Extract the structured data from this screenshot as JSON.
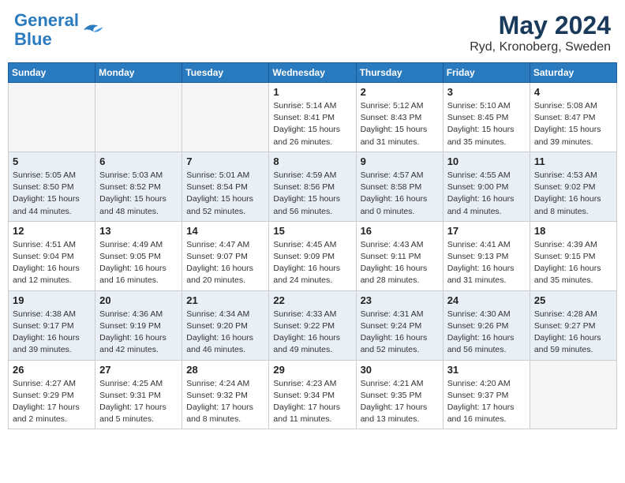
{
  "header": {
    "logo_line1": "General",
    "logo_line2": "Blue",
    "title": "May 2024",
    "subtitle": "Ryd, Kronoberg, Sweden"
  },
  "weekdays": [
    "Sunday",
    "Monday",
    "Tuesday",
    "Wednesday",
    "Thursday",
    "Friday",
    "Saturday"
  ],
  "weeks": [
    [
      {
        "day": "",
        "detail": ""
      },
      {
        "day": "",
        "detail": ""
      },
      {
        "day": "",
        "detail": ""
      },
      {
        "day": "1",
        "detail": "Sunrise: 5:14 AM\nSunset: 8:41 PM\nDaylight: 15 hours\nand 26 minutes."
      },
      {
        "day": "2",
        "detail": "Sunrise: 5:12 AM\nSunset: 8:43 PM\nDaylight: 15 hours\nand 31 minutes."
      },
      {
        "day": "3",
        "detail": "Sunrise: 5:10 AM\nSunset: 8:45 PM\nDaylight: 15 hours\nand 35 minutes."
      },
      {
        "day": "4",
        "detail": "Sunrise: 5:08 AM\nSunset: 8:47 PM\nDaylight: 15 hours\nand 39 minutes."
      }
    ],
    [
      {
        "day": "5",
        "detail": "Sunrise: 5:05 AM\nSunset: 8:50 PM\nDaylight: 15 hours\nand 44 minutes."
      },
      {
        "day": "6",
        "detail": "Sunrise: 5:03 AM\nSunset: 8:52 PM\nDaylight: 15 hours\nand 48 minutes."
      },
      {
        "day": "7",
        "detail": "Sunrise: 5:01 AM\nSunset: 8:54 PM\nDaylight: 15 hours\nand 52 minutes."
      },
      {
        "day": "8",
        "detail": "Sunrise: 4:59 AM\nSunset: 8:56 PM\nDaylight: 15 hours\nand 56 minutes."
      },
      {
        "day": "9",
        "detail": "Sunrise: 4:57 AM\nSunset: 8:58 PM\nDaylight: 16 hours\nand 0 minutes."
      },
      {
        "day": "10",
        "detail": "Sunrise: 4:55 AM\nSunset: 9:00 PM\nDaylight: 16 hours\nand 4 minutes."
      },
      {
        "day": "11",
        "detail": "Sunrise: 4:53 AM\nSunset: 9:02 PM\nDaylight: 16 hours\nand 8 minutes."
      }
    ],
    [
      {
        "day": "12",
        "detail": "Sunrise: 4:51 AM\nSunset: 9:04 PM\nDaylight: 16 hours\nand 12 minutes."
      },
      {
        "day": "13",
        "detail": "Sunrise: 4:49 AM\nSunset: 9:05 PM\nDaylight: 16 hours\nand 16 minutes."
      },
      {
        "day": "14",
        "detail": "Sunrise: 4:47 AM\nSunset: 9:07 PM\nDaylight: 16 hours\nand 20 minutes."
      },
      {
        "day": "15",
        "detail": "Sunrise: 4:45 AM\nSunset: 9:09 PM\nDaylight: 16 hours\nand 24 minutes."
      },
      {
        "day": "16",
        "detail": "Sunrise: 4:43 AM\nSunset: 9:11 PM\nDaylight: 16 hours\nand 28 minutes."
      },
      {
        "day": "17",
        "detail": "Sunrise: 4:41 AM\nSunset: 9:13 PM\nDaylight: 16 hours\nand 31 minutes."
      },
      {
        "day": "18",
        "detail": "Sunrise: 4:39 AM\nSunset: 9:15 PM\nDaylight: 16 hours\nand 35 minutes."
      }
    ],
    [
      {
        "day": "19",
        "detail": "Sunrise: 4:38 AM\nSunset: 9:17 PM\nDaylight: 16 hours\nand 39 minutes."
      },
      {
        "day": "20",
        "detail": "Sunrise: 4:36 AM\nSunset: 9:19 PM\nDaylight: 16 hours\nand 42 minutes."
      },
      {
        "day": "21",
        "detail": "Sunrise: 4:34 AM\nSunset: 9:20 PM\nDaylight: 16 hours\nand 46 minutes."
      },
      {
        "day": "22",
        "detail": "Sunrise: 4:33 AM\nSunset: 9:22 PM\nDaylight: 16 hours\nand 49 minutes."
      },
      {
        "day": "23",
        "detail": "Sunrise: 4:31 AM\nSunset: 9:24 PM\nDaylight: 16 hours\nand 52 minutes."
      },
      {
        "day": "24",
        "detail": "Sunrise: 4:30 AM\nSunset: 9:26 PM\nDaylight: 16 hours\nand 56 minutes."
      },
      {
        "day": "25",
        "detail": "Sunrise: 4:28 AM\nSunset: 9:27 PM\nDaylight: 16 hours\nand 59 minutes."
      }
    ],
    [
      {
        "day": "26",
        "detail": "Sunrise: 4:27 AM\nSunset: 9:29 PM\nDaylight: 17 hours\nand 2 minutes."
      },
      {
        "day": "27",
        "detail": "Sunrise: 4:25 AM\nSunset: 9:31 PM\nDaylight: 17 hours\nand 5 minutes."
      },
      {
        "day": "28",
        "detail": "Sunrise: 4:24 AM\nSunset: 9:32 PM\nDaylight: 17 hours\nand 8 minutes."
      },
      {
        "day": "29",
        "detail": "Sunrise: 4:23 AM\nSunset: 9:34 PM\nDaylight: 17 hours\nand 11 minutes."
      },
      {
        "day": "30",
        "detail": "Sunrise: 4:21 AM\nSunset: 9:35 PM\nDaylight: 17 hours\nand 13 minutes."
      },
      {
        "day": "31",
        "detail": "Sunrise: 4:20 AM\nSunset: 9:37 PM\nDaylight: 17 hours\nand 16 minutes."
      },
      {
        "day": "",
        "detail": ""
      }
    ]
  ],
  "colors": {
    "header_bg": "#2a7abf",
    "row_shade": "#e8eff7",
    "empty_bg": "#f5f5f5"
  }
}
